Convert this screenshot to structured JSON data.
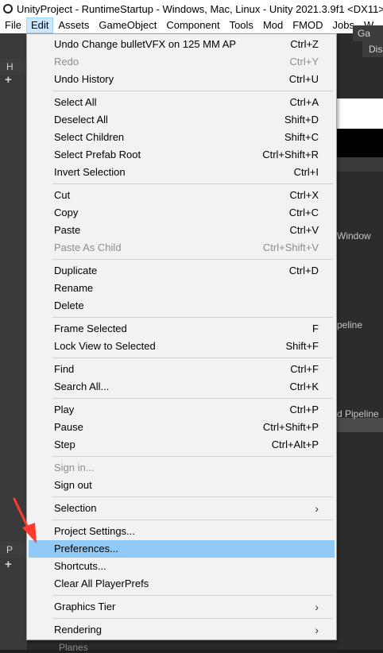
{
  "window": {
    "title": "UnityProject - RuntimeStartup - Windows, Mac, Linux - Unity 2021.3.9f1 <DX11>"
  },
  "menubar": {
    "items": [
      "File",
      "Edit",
      "Assets",
      "GameObject",
      "Component",
      "Tools",
      "Mod",
      "FMOD",
      "Jobs",
      "W"
    ],
    "active": "Edit"
  },
  "background": {
    "hierarchy_tab": "H",
    "project_tab": "P",
    "game_tab": "Ga",
    "display_label": "Dis",
    "snippet_window": "Window",
    "snippet_peline": "peline",
    "snippet_pipeline": "d Pipeline",
    "breadcrumb": "Planes"
  },
  "edit_menu": {
    "groups": [
      [
        {
          "label": "Undo Change bulletVFX on 125 MM AP",
          "shortcut": "Ctrl+Z",
          "enabled": true
        },
        {
          "label": "Redo",
          "shortcut": "Ctrl+Y",
          "enabled": false
        },
        {
          "label": "Undo History",
          "shortcut": "Ctrl+U",
          "enabled": true
        }
      ],
      [
        {
          "label": "Select All",
          "shortcut": "Ctrl+A",
          "enabled": true
        },
        {
          "label": "Deselect All",
          "shortcut": "Shift+D",
          "enabled": true
        },
        {
          "label": "Select Children",
          "shortcut": "Shift+C",
          "enabled": true
        },
        {
          "label": "Select Prefab Root",
          "shortcut": "Ctrl+Shift+R",
          "enabled": true
        },
        {
          "label": "Invert Selection",
          "shortcut": "Ctrl+I",
          "enabled": true
        }
      ],
      [
        {
          "label": "Cut",
          "shortcut": "Ctrl+X",
          "enabled": true
        },
        {
          "label": "Copy",
          "shortcut": "Ctrl+C",
          "enabled": true
        },
        {
          "label": "Paste",
          "shortcut": "Ctrl+V",
          "enabled": true
        },
        {
          "label": "Paste As Child",
          "shortcut": "Ctrl+Shift+V",
          "enabled": false
        }
      ],
      [
        {
          "label": "Duplicate",
          "shortcut": "Ctrl+D",
          "enabled": true
        },
        {
          "label": "Rename",
          "shortcut": "",
          "enabled": true
        },
        {
          "label": "Delete",
          "shortcut": "",
          "enabled": true
        }
      ],
      [
        {
          "label": "Frame Selected",
          "shortcut": "F",
          "enabled": true
        },
        {
          "label": "Lock View to Selected",
          "shortcut": "Shift+F",
          "enabled": true
        }
      ],
      [
        {
          "label": "Find",
          "shortcut": "Ctrl+F",
          "enabled": true
        },
        {
          "label": "Search All...",
          "shortcut": "Ctrl+K",
          "enabled": true
        }
      ],
      [
        {
          "label": "Play",
          "shortcut": "Ctrl+P",
          "enabled": true
        },
        {
          "label": "Pause",
          "shortcut": "Ctrl+Shift+P",
          "enabled": true
        },
        {
          "label": "Step",
          "shortcut": "Ctrl+Alt+P",
          "enabled": true
        }
      ],
      [
        {
          "label": "Sign in...",
          "shortcut": "",
          "enabled": false
        },
        {
          "label": "Sign out",
          "shortcut": "",
          "enabled": true
        }
      ],
      [
        {
          "label": "Selection",
          "shortcut": "",
          "enabled": true,
          "submenu": true
        }
      ],
      [
        {
          "label": "Project Settings...",
          "shortcut": "",
          "enabled": true
        },
        {
          "label": "Preferences...",
          "shortcut": "",
          "enabled": true,
          "highlighted": true
        },
        {
          "label": "Shortcuts...",
          "shortcut": "",
          "enabled": true
        },
        {
          "label": "Clear All PlayerPrefs",
          "shortcut": "",
          "enabled": true
        }
      ],
      [
        {
          "label": "Graphics Tier",
          "shortcut": "",
          "enabled": true,
          "submenu": true
        }
      ],
      [
        {
          "label": "Rendering",
          "shortcut": "",
          "enabled": true,
          "submenu": true
        }
      ]
    ]
  },
  "colors": {
    "highlight": "#91c9f7",
    "menu_bg": "#f2f2f2",
    "disabled_text": "#8d8d8d",
    "annotation_arrow": "#ff3b30"
  }
}
